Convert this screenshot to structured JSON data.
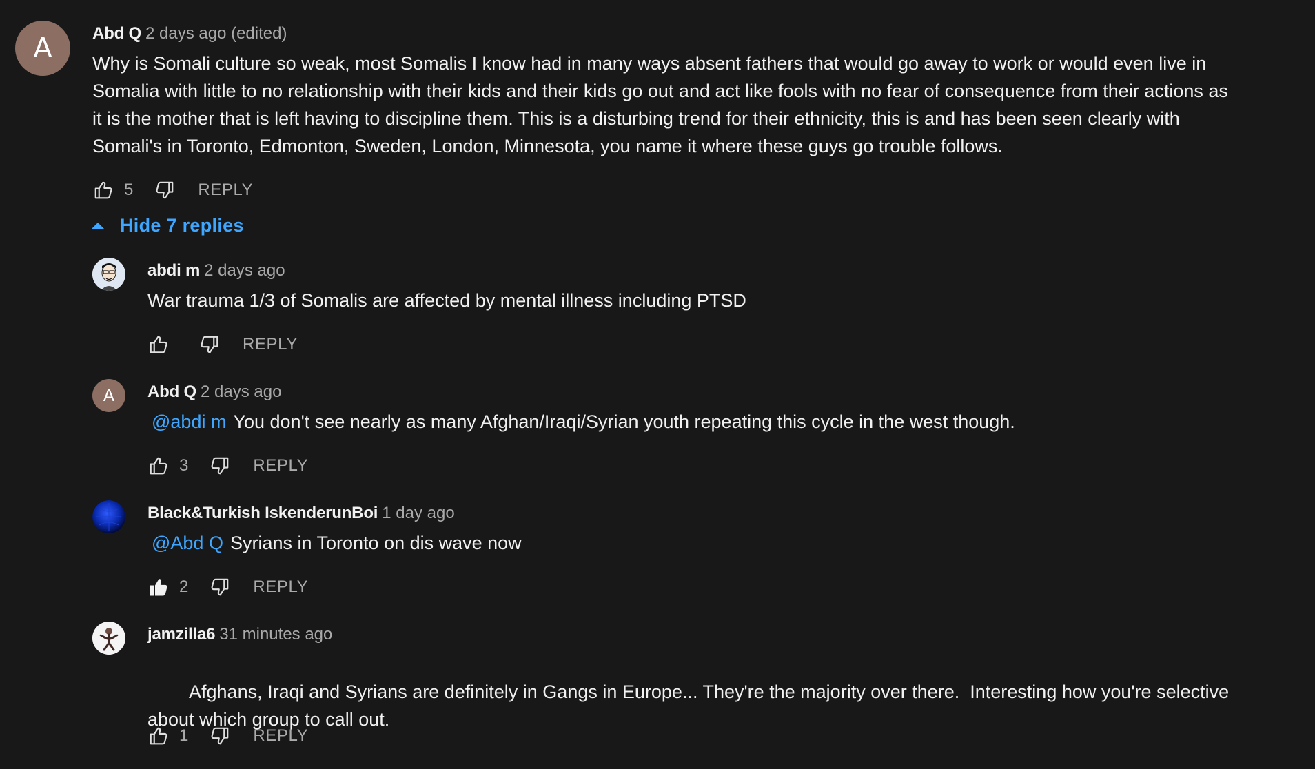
{
  "colors": {
    "background": "#181818",
    "accent": "#3ea6ff",
    "muted": "#aaaaaa"
  },
  "top_comment": {
    "avatar_letter": "A",
    "author": "Abd Q",
    "time": "2 days ago (edited)",
    "text": "Why is Somali culture so weak, most Somalis I know had in many ways absent fathers that would go away to work or would even live in Somalia with little to no relationship with their kids and their kids go out and act like fools with no fear of consequence from their actions as it is the mother that is left having to discipline them. This is a disturbing trend for their ethnicity, this is and has been seen clearly with Somali's in Toronto, Edmonton, Sweden, London, Minnesota, you name it where these guys go trouble follows.",
    "likes": "5",
    "reply_label": "REPLY"
  },
  "replies_toggle": {
    "label": "Hide 7 replies",
    "icon": "caret-up-icon"
  },
  "replies": [
    {
      "avatar": "cartoon-face-avatar",
      "author": "abdi m",
      "time": "2 days ago",
      "mention": "",
      "text": "War trauma 1/3 of Somalis are affected by mental illness including PTSD",
      "likes": "",
      "liked": false,
      "reply_label": "REPLY"
    },
    {
      "avatar_letter": "A",
      "author": "Abd Q",
      "time": "2 days ago",
      "mention": "@abdi m",
      "text": "You don't see nearly as many Afghan/Iraqi/Syrian youth repeating this cycle in the west though.",
      "likes": "3",
      "liked": false,
      "reply_label": "REPLY"
    },
    {
      "avatar": "blue-globe-avatar",
      "author": "Black&Turkish IskenderunBoi",
      "time": "1 day ago",
      "mention": "@Abd Q",
      "text": "Syrians in Toronto on dis wave now",
      "likes": "2",
      "liked": true,
      "reply_label": "REPLY"
    },
    {
      "avatar": "figure-sketch-avatar",
      "author": "jamzilla6",
      "time": "31 minutes ago",
      "mention": "",
      "text": "Afghans, Iraqi and Syrians are definitely in Gangs in Europe... They're the majority over there.  Interesting how you're selective about which group to call out.",
      "likes": "1",
      "liked": false,
      "reply_label": "REPLY"
    }
  ]
}
